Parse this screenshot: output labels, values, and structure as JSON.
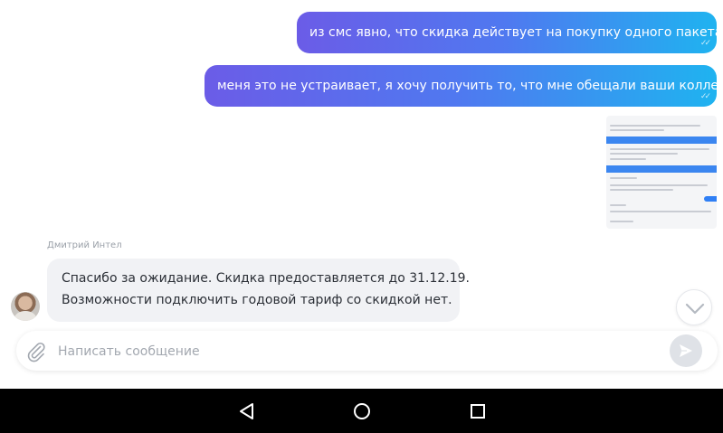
{
  "messages": {
    "outgoing": [
      {
        "text": "из смс явно, что скидка действует на покупку одного пакета.",
        "status": "read"
      },
      {
        "text": "меня это не устраивает, я хочу получить то, что мне обещали ваши коллеги",
        "status": "read"
      }
    ],
    "incoming": {
      "sender": "Дмитрий Интел",
      "lines": [
        "Спасибо за ожидание. Скидка предоставляется до 31.12.19.",
        "Возможности подключить годовой тариф со скидкой нет."
      ]
    }
  },
  "composer": {
    "placeholder": "Написать сообщение",
    "value": ""
  },
  "icons": {
    "attach": "paperclip-icon",
    "send": "send-icon",
    "scroll": "chevron-down-icon",
    "read_status": "double-check-icon",
    "nav_back": "triangle-back-icon",
    "nav_home": "circle-home-icon",
    "nav_recent": "square-recent-icon"
  },
  "colors": {
    "gradient_start": "#6b5ce7",
    "gradient_end": "#1fb3f0",
    "incoming_bg": "#f1f2f5",
    "navbar": "#000000"
  }
}
